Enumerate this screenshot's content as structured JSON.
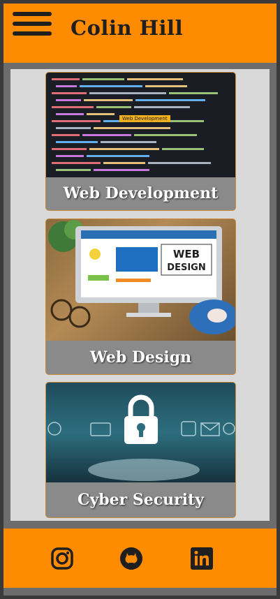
{
  "header": {
    "title": "Colin Hill"
  },
  "cards": [
    {
      "label": "Web Development",
      "image_badge": "Web Development"
    },
    {
      "label": "Web Design"
    },
    {
      "label": "Cyber Security"
    }
  ],
  "social": [
    "instagram-icon",
    "github-icon",
    "linkedin-icon"
  ],
  "colors": {
    "accent": "#ff8c00",
    "frame": "#6d6d6d",
    "content_bg": "#d9d9d9",
    "card_label_bg": "#8a8a8a"
  }
}
